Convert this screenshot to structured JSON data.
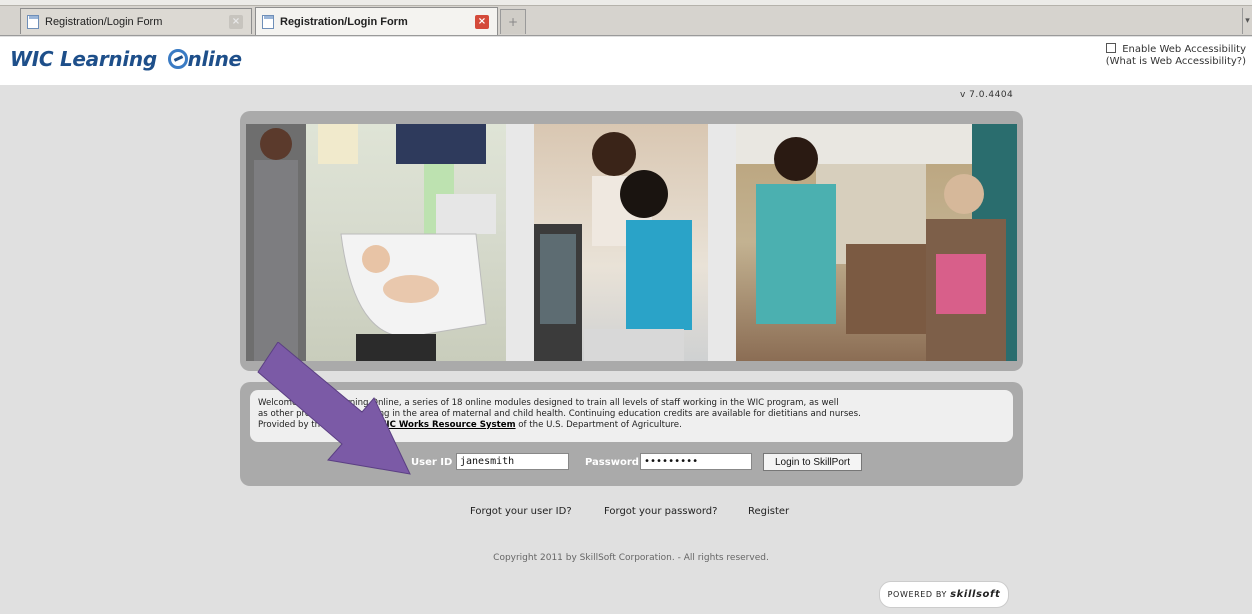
{
  "browser": {
    "tabs": [
      {
        "label": "Registration/Login Form",
        "active": false
      },
      {
        "label": "Registration/Login Form",
        "active": true
      }
    ],
    "new_tab_label": "+"
  },
  "header": {
    "logo_text": "WIC Learning ",
    "logo_text_end": "nline",
    "accessibility_label": "Enable Web Accessibility",
    "accessibility_link": "(What is Web Accessibility?)"
  },
  "version": "v 7.0.4404",
  "welcome": {
    "line1": "Welcome to WIC Learning Online, a series of 18 online modules designed to train all levels of staff working in the WIC program, as well",
    "line2": "as other professionals working in the area of maternal and child health. Continuing education credits are available for dietitians and nurses.",
    "line3_prefix": "Provided by the WIC Works ",
    "line3_link": "WIC Works Resource System",
    "line3_suffix": " of the U.S. Department of Agriculture."
  },
  "login": {
    "user_id_label": "User ID",
    "user_id_value": "janesmith",
    "password_label": "Password",
    "password_value": "•••••••••",
    "submit_label": "Login to SkillPort"
  },
  "links": {
    "forgot_user": "Forgot your user ID?",
    "forgot_password": "Forgot your password?",
    "register": "Register"
  },
  "copyright": "Copyright 2011 by SkillSoft Corporation. - All rights reserved.",
  "badge": {
    "prefix": "POWERED BY ",
    "brand": "skillsoft"
  },
  "colors": {
    "arrow": "#7b5aa6",
    "panel": "#aaaaaa",
    "logo": "#1e4f8a"
  }
}
